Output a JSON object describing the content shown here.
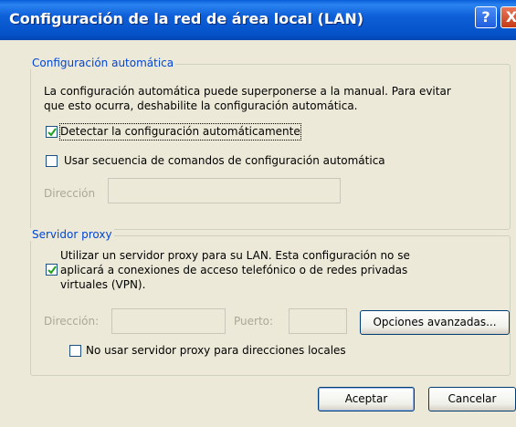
{
  "window": {
    "title": "Configuración de la red de área local (LAN)",
    "help_glyph": "?",
    "close_glyph": "X"
  },
  "auto_config": {
    "legend": "Configuración automática",
    "description_line1": "La configuración automática puede superponerse a la manual. Para evitar",
    "description_line2": "que esto ocurra, deshabilite la configuración automática.",
    "detect_label": "Detectar la configuración automáticamente",
    "detect_checked": true,
    "script_label": "Usar secuencia de comandos de configuración automática",
    "script_checked": false,
    "address_label": "Dirección",
    "address_value": ""
  },
  "proxy": {
    "legend": "Servidor proxy",
    "use_proxy_line1": "Utilizar un servidor proxy para su LAN. Esta configuración no se",
    "use_proxy_line2": "aplicará a conexiones de acceso telefónico o de redes privadas",
    "use_proxy_line3": "virtuales (VPN).",
    "use_proxy_checked": true,
    "address_label": "Dirección:",
    "address_value": "",
    "port_label": "Puerto:",
    "port_value": "",
    "advanced_button": "Opciones avanzadas...",
    "bypass_label": "No usar servidor proxy para direcciones locales",
    "bypass_checked": false
  },
  "buttons": {
    "ok": "Aceptar",
    "cancel": "Cancelar"
  }
}
